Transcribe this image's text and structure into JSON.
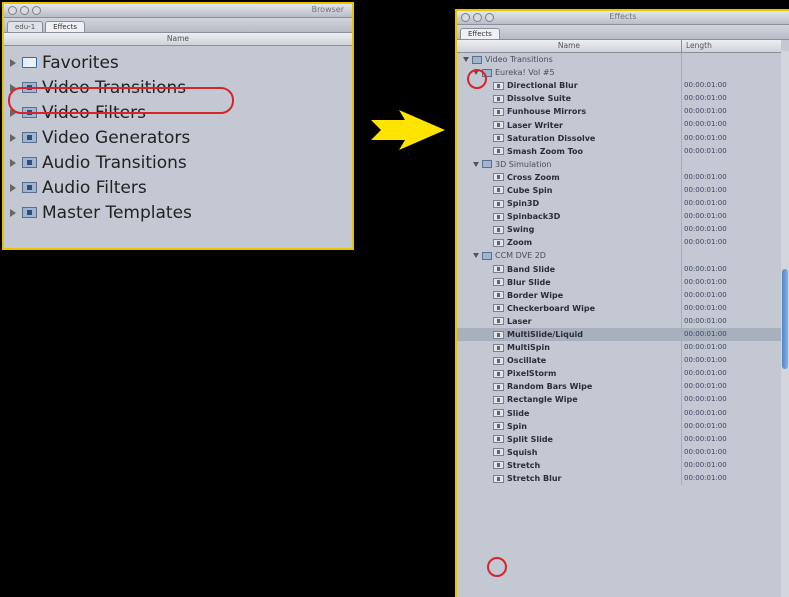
{
  "browser": {
    "title": "Browser",
    "tabs": [
      "edu-1",
      "Effects"
    ],
    "column": "Name",
    "items": [
      {
        "label": "Favorites",
        "icon": "folder-icon"
      },
      {
        "label": "Video Transitions",
        "icon": "bin-icon"
      },
      {
        "label": "Video Filters",
        "icon": "bin-icon"
      },
      {
        "label": "Video Generators",
        "icon": "bin-icon"
      },
      {
        "label": "Audio Transitions",
        "icon": "bin-icon"
      },
      {
        "label": "Audio Filters",
        "icon": "bin-icon"
      },
      {
        "label": "Master Templates",
        "icon": "bin-icon"
      }
    ]
  },
  "effects": {
    "title": "Effects",
    "tab": "Effects",
    "columns": {
      "name": "Name",
      "length": "Length"
    },
    "rows": [
      {
        "kind": "root",
        "label": "Video Transitions",
        "length": ""
      },
      {
        "kind": "group",
        "label": "Eureka! Vol #5",
        "length": ""
      },
      {
        "kind": "item",
        "label": "Directional Blur",
        "length": "00:00:01:00"
      },
      {
        "kind": "item",
        "label": "Dissolve Suite",
        "length": "00:00:01:00"
      },
      {
        "kind": "item",
        "label": "Funhouse Mirrors",
        "length": "00:00:01:00"
      },
      {
        "kind": "item",
        "label": "Laser Writer",
        "length": "00:00:01:00"
      },
      {
        "kind": "item",
        "label": "Saturation Dissolve",
        "length": "00:00:01:00"
      },
      {
        "kind": "item",
        "label": "Smash Zoom Too",
        "length": "00:00:01:00"
      },
      {
        "kind": "group",
        "label": "3D Simulation",
        "length": ""
      },
      {
        "kind": "item",
        "label": "Cross Zoom",
        "length": "00:00:01:00"
      },
      {
        "kind": "item",
        "label": "Cube Spin",
        "length": "00:00:01:00"
      },
      {
        "kind": "item",
        "label": "Spin3D",
        "length": "00:00:01:00"
      },
      {
        "kind": "item",
        "label": "Spinback3D",
        "length": "00:00:01:00"
      },
      {
        "kind": "item",
        "label": "Swing",
        "length": "00:00:01:00"
      },
      {
        "kind": "item",
        "label": "Zoom",
        "length": "00:00:01:00"
      },
      {
        "kind": "group",
        "label": "CCM DVE 2D",
        "length": ""
      },
      {
        "kind": "item",
        "label": "Band Slide",
        "length": "00:00:01:00"
      },
      {
        "kind": "item",
        "label": "Blur Slide",
        "length": "00:00:01:00"
      },
      {
        "kind": "item",
        "label": "Border Wipe",
        "length": "00:00:01:00"
      },
      {
        "kind": "item",
        "label": "Checkerboard Wipe",
        "length": "00:00:01:00"
      },
      {
        "kind": "item",
        "label": "Laser",
        "length": "00:00:01:00"
      },
      {
        "kind": "item",
        "label": "MultiSlide/Liquid",
        "length": "00:00:01:00"
      },
      {
        "kind": "item",
        "label": "MultiSpin",
        "length": "00:00:01:00"
      },
      {
        "kind": "item",
        "label": "Oscillate",
        "length": "00:00:01:00"
      },
      {
        "kind": "item",
        "label": "PixelStorm",
        "length": "00:00:01:00"
      },
      {
        "kind": "item",
        "label": "Random Bars Wipe",
        "length": "00:00:01:00"
      },
      {
        "kind": "item",
        "label": "Rectangle Wipe",
        "length": "00:00:01:00"
      },
      {
        "kind": "item",
        "label": "Slide",
        "length": "00:00:01:00"
      },
      {
        "kind": "item",
        "label": "Spin",
        "length": "00:00:01:00"
      },
      {
        "kind": "item",
        "label": "Split Slide",
        "length": "00:00:01:00"
      },
      {
        "kind": "item",
        "label": "Squish",
        "length": "00:00:01:00"
      },
      {
        "kind": "item",
        "label": "Stretch",
        "length": "00:00:01:00"
      },
      {
        "kind": "item",
        "label": "Stretch Blur",
        "length": "00:00:01:00"
      }
    ]
  },
  "colors": {
    "frame": "#e9c400",
    "highlight": "#d6252a",
    "arrow": "#ffe400"
  }
}
